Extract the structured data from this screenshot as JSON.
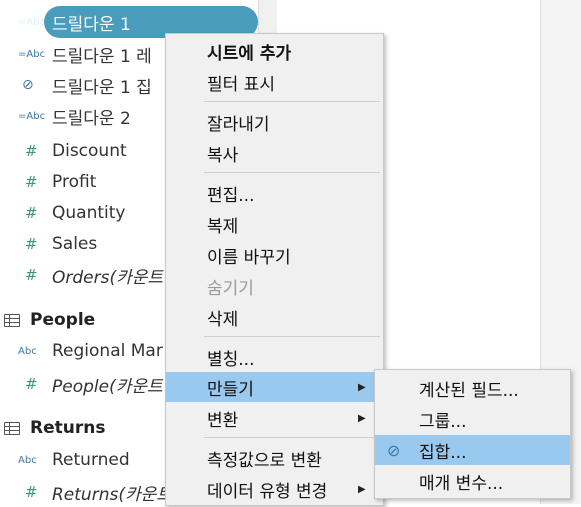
{
  "fields_top": [
    {
      "icon": "abc-icon",
      "icon_text": "=Abc",
      "label": "드릴다운 1",
      "selected": true
    },
    {
      "icon": "abc-icon",
      "icon_text": "=Abc",
      "label": "드릴다운 1 레"
    },
    {
      "icon": "set-icon",
      "icon_text": "⊘",
      "label": "드릴다운 1 집"
    },
    {
      "icon": "abc-icon",
      "icon_text": "=Abc",
      "label": "드릴다운 2"
    },
    {
      "icon": "hash-icon",
      "icon_text": "#",
      "label": "Discount"
    },
    {
      "icon": "hash-icon",
      "icon_text": "#",
      "label": "Profit"
    },
    {
      "icon": "hash-icon",
      "icon_text": "#",
      "label": "Quantity"
    },
    {
      "icon": "hash-icon",
      "icon_text": "#",
      "label": "Sales"
    },
    {
      "icon": "hash-icon",
      "icon_text": "#",
      "label": "Orders(카운트",
      "italic": true
    }
  ],
  "people": {
    "title": "People",
    "fields": [
      {
        "icon": "abc-icon",
        "icon_text": "Abc",
        "label": "Regional Mar"
      },
      {
        "icon": "hash-icon",
        "icon_text": "#",
        "label": "People(카운트",
        "italic": true
      }
    ]
  },
  "returns": {
    "title": "Returns",
    "fields": [
      {
        "icon": "abc-icon",
        "icon_text": "Abc",
        "label": "Returned"
      },
      {
        "icon": "hash-icon",
        "icon_text": "#",
        "label": "Returns(카운트",
        "italic": true
      }
    ]
  },
  "menu": {
    "items": [
      {
        "label": "시트에 추가",
        "bold": true
      },
      {
        "label": "필터 표시"
      },
      {
        "label": "잘라내기"
      },
      {
        "label": "복사"
      },
      {
        "label": "편집..."
      },
      {
        "label": "복제"
      },
      {
        "label": "이름 바꾸기"
      },
      {
        "label": "숨기기",
        "disabled": true
      },
      {
        "label": "삭제"
      },
      {
        "label": "별칭..."
      },
      {
        "label": "만들기",
        "submenu": true,
        "highlighted": true
      },
      {
        "label": "변환",
        "submenu": true
      },
      {
        "label": "측정값으로 변환"
      },
      {
        "label": "데이터 유형 변경",
        "submenu": true
      }
    ],
    "arrow": "▶"
  },
  "submenu": {
    "items": [
      {
        "label": "계산된 필드..."
      },
      {
        "label": "그룹..."
      },
      {
        "label": "집합...",
        "highlighted": true,
        "icon_text": "⊘"
      },
      {
        "label": "매개 변수..."
      }
    ]
  }
}
